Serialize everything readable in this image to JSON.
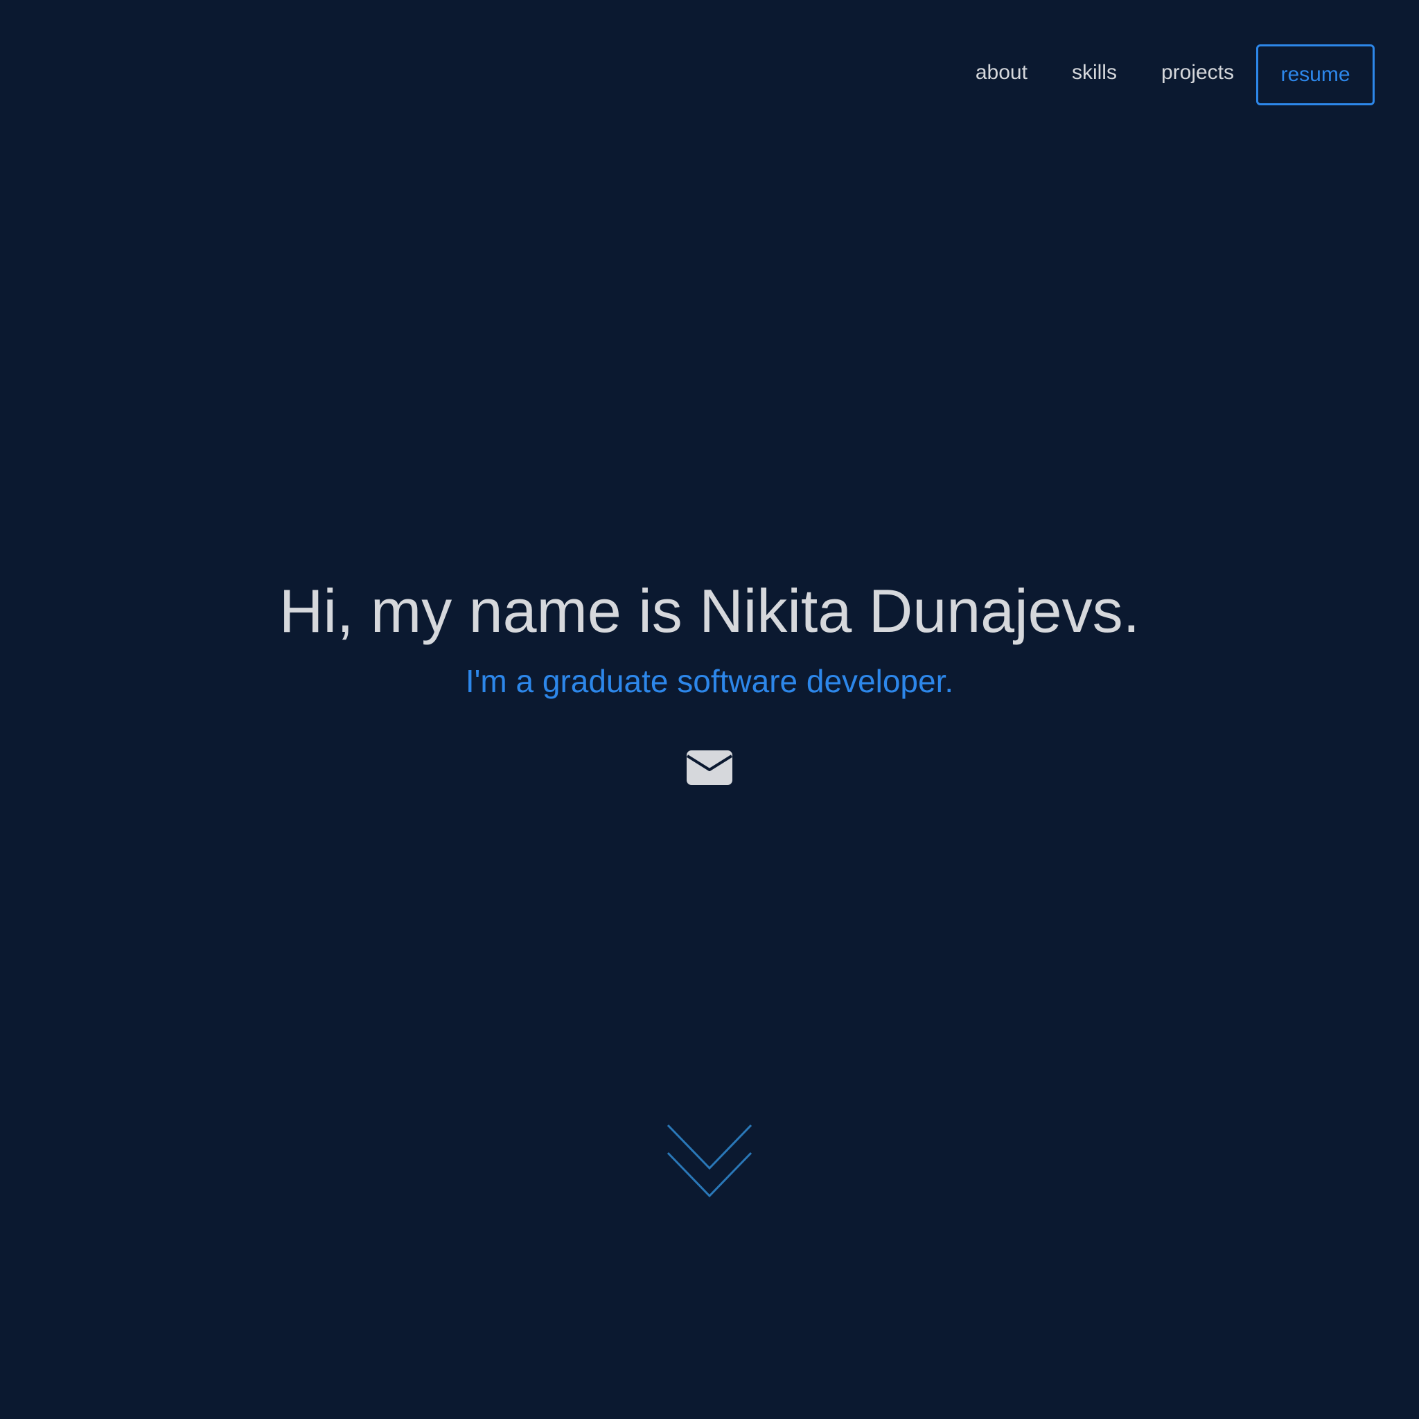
{
  "nav": {
    "items": [
      {
        "label": "about"
      },
      {
        "label": "skills"
      },
      {
        "label": "projects"
      }
    ],
    "resume_label": "resume"
  },
  "hero": {
    "title": "Hi, my name is Nikita Dunajevs.",
    "subtitle": "I'm a graduate software developer.",
    "contact_icon": "mail-icon",
    "scroll_icon": "double-chevron-down-icon"
  },
  "colors": {
    "background": "#0b1930",
    "text": "#d6d8dc",
    "accent": "#2d87ea",
    "chevron": "#2a78b8"
  }
}
